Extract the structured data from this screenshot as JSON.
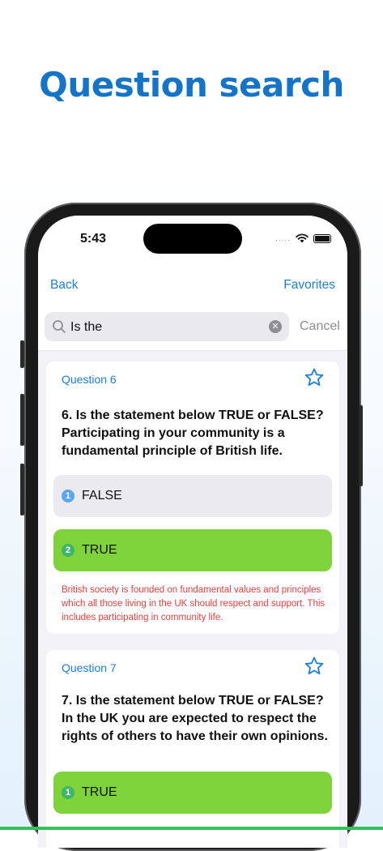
{
  "promo": {
    "headline": "Question search"
  },
  "status_bar": {
    "time": "5:43",
    "signal_dots": "....."
  },
  "nav": {
    "back_label": "Back",
    "favorites_label": "Favorites"
  },
  "search": {
    "value": "Is the",
    "cancel_label": "Cancel"
  },
  "colors": {
    "accent": "#1a7fe0",
    "correct": "#7ed33b",
    "explanation": "#f03c3c",
    "headline": "#1474c8"
  },
  "questions": [
    {
      "label": "Question 6",
      "text": "6. Is the statement below TRUE or FALSE? Participating in your community is a fundamental principle of British life.",
      "answers": [
        {
          "num": "1",
          "text": "FALSE",
          "state": "neutral"
        },
        {
          "num": "2",
          "text": "TRUE",
          "state": "correct"
        }
      ],
      "explanation": "British society is founded on fundamental values and principles which all those living in the UK should respect and support. This includes participating in community life."
    },
    {
      "label": "Question 7",
      "text": "7. Is the statement below TRUE or FALSE? In the UK you are expected to respect the rights of others to have their own opinions.",
      "answers": [
        {
          "num": "1",
          "text": "TRUE",
          "state": "correct"
        }
      ]
    }
  ]
}
